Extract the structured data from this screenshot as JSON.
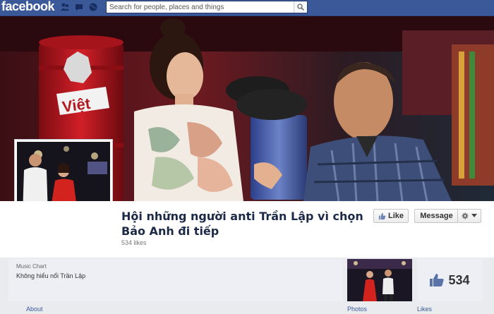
{
  "topbar": {
    "logo": "facebook",
    "search_placeholder": "Search for people, places and things"
  },
  "page": {
    "title": "Hội những người anti Trần Lập vì chọn Bảo Anh đi tiếp",
    "likes_line": "534 likes",
    "like_button": "Like",
    "message_button": "Message",
    "category": "Music Chart",
    "description": "Không hiểu nổi Trần Lập",
    "like_count": "534"
  },
  "cover": {
    "logo_text": "Việt"
  },
  "tabs": {
    "about": "About",
    "photos": "Photos",
    "likes": "Likes"
  },
  "colors": {
    "brand": "#3b5998",
    "title": "#1c2a47"
  }
}
